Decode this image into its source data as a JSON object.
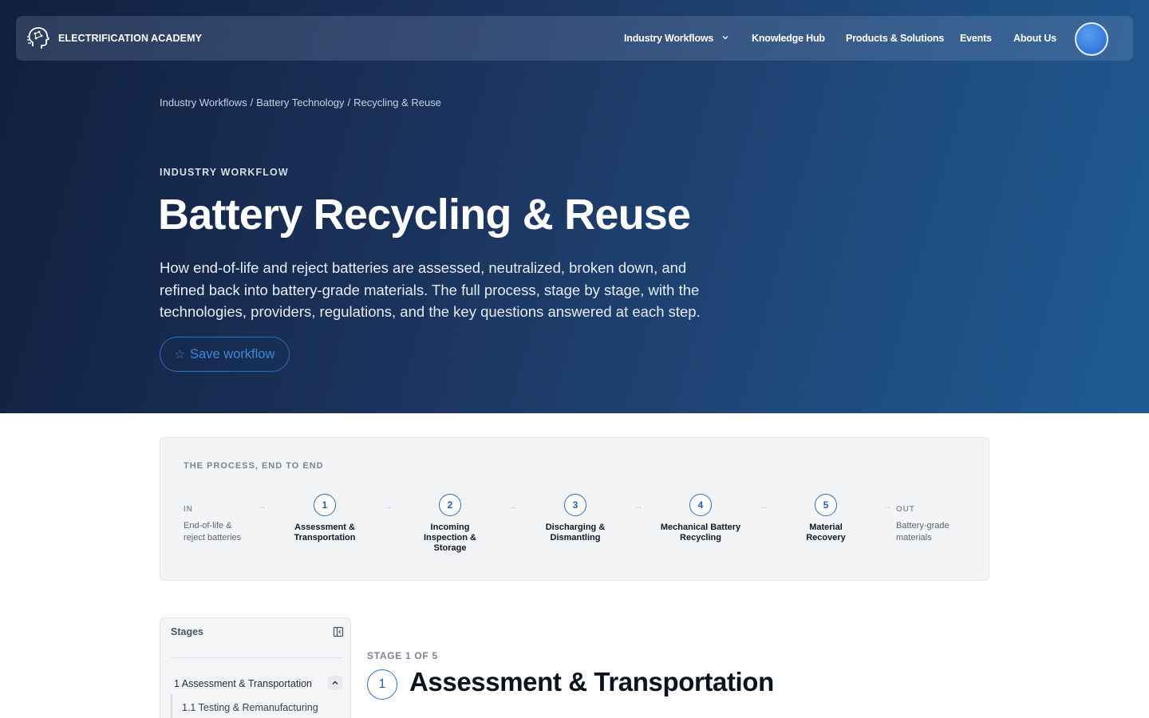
{
  "nav": {
    "brand": "ELECTRIFICATION ACADEMY",
    "links": [
      "Industry Workflows",
      "Knowledge Hub",
      "Products & Solutions",
      "Events",
      "About Us"
    ]
  },
  "breadcrumb": [
    "Industry Workflows",
    "Battery Technology",
    "Recycling & Reuse"
  ],
  "hero": {
    "eyebrow": "INDUSTRY WORKFLOW",
    "title": "Battery Recycling & Reuse",
    "description": "How end-of-life and reject batteries are assessed, neutralized, broken down, and refined back into battery-grade materials. The full process, stage by stage, with the technologies, providers, regulations, and the key questions answered at each step.",
    "save_star": "☆",
    "save_label": "Save workflow"
  },
  "process": {
    "label": "THE PROCESS, END TO END",
    "in_tag": "IN",
    "in_text": "End-of-life & reject batteries",
    "out_tag": "OUT",
    "out_text": "Battery-grade materials",
    "arrow": "→",
    "steps": [
      {
        "num": "1",
        "name": "Assessment & Transportation"
      },
      {
        "num": "2",
        "name": "Incoming Inspection & Storage"
      },
      {
        "num": "3",
        "name": "Discharging & Dismantling"
      },
      {
        "num": "4",
        "name": "Mechanical Battery Recycling"
      },
      {
        "num": "5",
        "name": "Material Recovery"
      }
    ]
  },
  "stages_panel": {
    "title": "Stages",
    "item": "1 Assessment & Transportation",
    "sub_item": "1.1 Testing & Remanufacturing"
  },
  "stage": {
    "eyebrow": "STAGE 1 OF 5",
    "number": "1",
    "title": "Assessment & Transportation"
  },
  "colors": {
    "accent": "#2c6fbc",
    "hero_start": "#101f3d",
    "hero_end": "#1d5b93"
  }
}
